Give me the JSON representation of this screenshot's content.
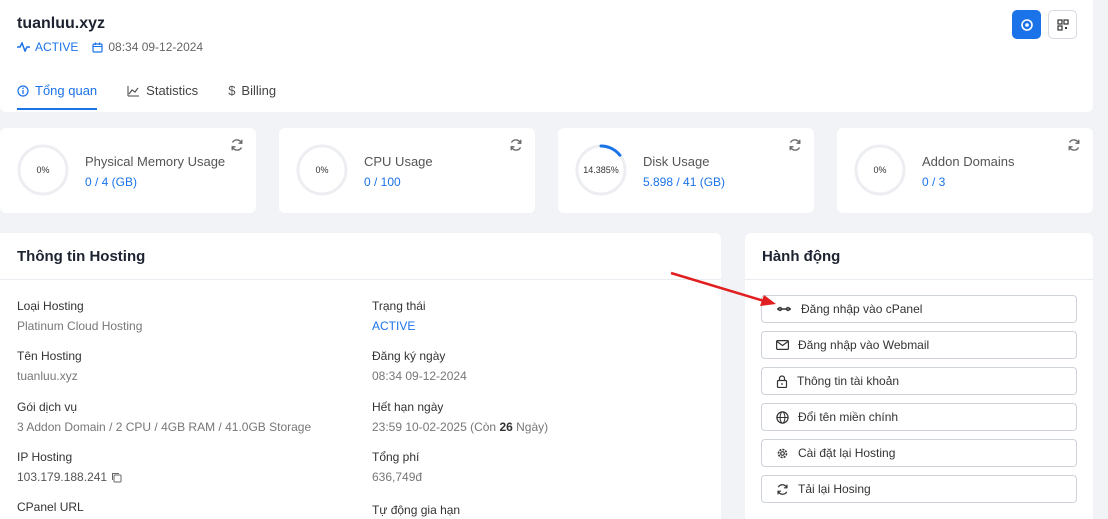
{
  "header": {
    "domain": "tuanluu.xyz",
    "status": "ACTIVE",
    "datetime": "08:34 09-12-2024",
    "tabs": [
      {
        "label": "Tổng quan",
        "icon": "info-circle-icon",
        "active": true
      },
      {
        "label": "Statistics",
        "icon": "chart-area-icon",
        "active": false
      },
      {
        "label": "Billing",
        "icon": "dollar-icon",
        "active": false
      }
    ]
  },
  "stats": [
    {
      "title": "Physical Memory Usage",
      "value": "0 / 4 (GB)",
      "percent_label": "0%",
      "fraction": 0
    },
    {
      "title": "CPU Usage",
      "value": "0 / 100",
      "percent_label": "0%",
      "fraction": 0
    },
    {
      "title": "Disk Usage",
      "value": "5.898 / 41 (GB)",
      "percent_label": "14.385%",
      "fraction": 0.14385
    },
    {
      "title": "Addon Domains",
      "value": "0 / 3",
      "percent_label": "0%",
      "fraction": 0
    }
  ],
  "hosting": {
    "title": "Thông tin Hosting",
    "fields": {
      "type_label": "Loại Hosting",
      "type_value": "Platinum Cloud Hosting",
      "status_label": "Trạng thái",
      "status_value": "ACTIVE",
      "name_label": "Tên Hosting",
      "name_value": "tuanluu.xyz",
      "registered_label": "Đăng ký ngày",
      "registered_value": "08:34 09-12-2024",
      "package_label": "Gói dịch vụ",
      "package_value": "3 Addon Domain / 2 CPU / 4GB RAM / 41.0GB Storage",
      "expires_label": "Hết hạn ngày",
      "expires_value": "23:59 10-02-2025 (Còn ",
      "expires_days": "26",
      "expires_suffix": " Ngày)",
      "ip_label": "IP Hosting",
      "ip_value": "103.179.188.241",
      "total_label": "Tổng phí",
      "total_value": "636,749đ",
      "cpanel_label": "CPanel URL",
      "autorenew_label": "Tự động gia hạn"
    }
  },
  "actions": {
    "title": "Hành động",
    "buttons": [
      {
        "label": "Đăng nhập vào cPanel",
        "icon": "cpanel-icon"
      },
      {
        "label": "Đăng nhập vào Webmail",
        "icon": "envelope-icon"
      },
      {
        "label": "Thông tin tài khoản",
        "icon": "lock-icon"
      },
      {
        "label": "Đổi tên miền chính",
        "icon": "globe-icon"
      },
      {
        "label": "Cài đặt lại Hosting",
        "icon": "gear-icon"
      },
      {
        "label": "Tải lại Hosing",
        "icon": "refresh-icon"
      }
    ]
  },
  "colors": {
    "accent": "#1a73e8",
    "arrow": "#e02020"
  }
}
